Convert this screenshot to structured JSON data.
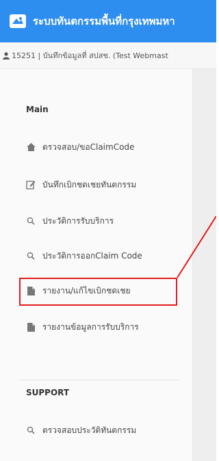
{
  "header": {
    "title": "ระบบทันตกรรมพื้นที่กรุงเทพมหา",
    "logo_icon": "app-logo-icon",
    "bg_color": "#2e8ef0"
  },
  "userbar": {
    "icon": "user-icon",
    "text": "15251 | บันทึกข้อมูลที่ สปสช. (Test Webmast"
  },
  "sidebar": {
    "main_title": "Main",
    "items": [
      {
        "label": "ตรวจสอบ/ขอClaimCode",
        "icon": "home-icon"
      },
      {
        "label": "บันทึกเบิกชดเชยทันตกรรม",
        "icon": "edit-icon"
      },
      {
        "label": "ประวัติการรับบริการ",
        "icon": "search-icon"
      },
      {
        "label": "ประวัติการออกClaim Code",
        "icon": "search-icon"
      },
      {
        "label": "รายงาน/แก้ไขเบิกชดเชย",
        "icon": "file-icon"
      },
      {
        "label": "รายงานข้อมูลการรับบริการ",
        "icon": "file-icon"
      }
    ],
    "support_title": "SUPPORT",
    "support_items": [
      {
        "label": "ตรวจสอบประวัติทันตกรรม",
        "icon": "search-icon"
      }
    ]
  },
  "annotation": {
    "color": "#e41b1b",
    "highlighted_item": "รายงาน/แก้ไขเบิกชดเชย"
  }
}
